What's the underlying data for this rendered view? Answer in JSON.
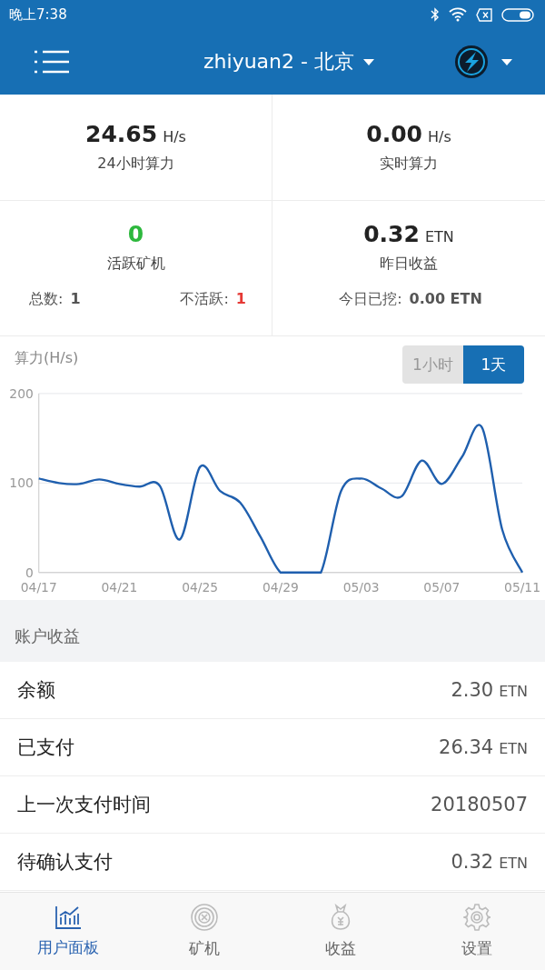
{
  "status_bar": {
    "time": "晚上7:38"
  },
  "header": {
    "title": "zhiyuan2 - 北京"
  },
  "stats": [
    {
      "value": "24.65",
      "unit": "H/s",
      "label": "24小时算力"
    },
    {
      "value": "0.00",
      "unit": "H/s",
      "label": "实时算力"
    },
    {
      "value": "0",
      "label": "活跃矿机",
      "color": "#2db83d",
      "details": [
        {
          "label": "总数:",
          "value": "1"
        },
        {
          "label": "不活跃:",
          "value": "1",
          "color": "#e53935"
        }
      ]
    },
    {
      "value": "0.32",
      "unit": "ETN",
      "label": "昨日收益",
      "details": [
        {
          "label": "今日已挖:",
          "value": "0.00 ETN"
        }
      ]
    }
  ],
  "hashrate_chart": {
    "title": "算力(H/s)",
    "range_toggle": [
      {
        "label": "1小时",
        "selected": false
      },
      {
        "label": "1天",
        "selected": true
      }
    ],
    "chart_data": {
      "type": "line",
      "categories": [
        "04/17",
        null,
        null,
        null,
        "04/21",
        null,
        null,
        null,
        "04/25",
        null,
        null,
        null,
        "04/29",
        null,
        null,
        null,
        "05/03",
        null,
        null,
        null,
        "05/07",
        null,
        null,
        null,
        "05/11"
      ],
      "series": [
        {
          "color": "#1f5fae",
          "values": [
            105,
            100,
            99,
            104,
            99,
            96,
            97,
            37,
            118,
            91,
            78,
            40,
            0,
            0,
            0,
            91,
            105,
            94,
            85,
            125,
            99,
            129,
            162,
            48,
            0
          ]
        }
      ],
      "ylim": [
        0,
        200
      ],
      "yticks": [
        0,
        100,
        200
      ]
    }
  },
  "account": {
    "title": "账户收益",
    "rows": [
      {
        "label": "余额",
        "value": "2.30",
        "unit": "ETN"
      },
      {
        "label": "已支付",
        "value": "26.34",
        "unit": "ETN"
      },
      {
        "label": "上一次支付时间",
        "value": "20180507"
      },
      {
        "label": "待确认支付",
        "value": "0.32",
        "unit": "ETN"
      }
    ]
  },
  "tab_bar": [
    {
      "label": "用户面板",
      "selected": true
    },
    {
      "label": "矿机",
      "selected": false
    },
    {
      "label": "收益",
      "selected": false
    },
    {
      "label": "设置",
      "selected": false
    }
  ]
}
